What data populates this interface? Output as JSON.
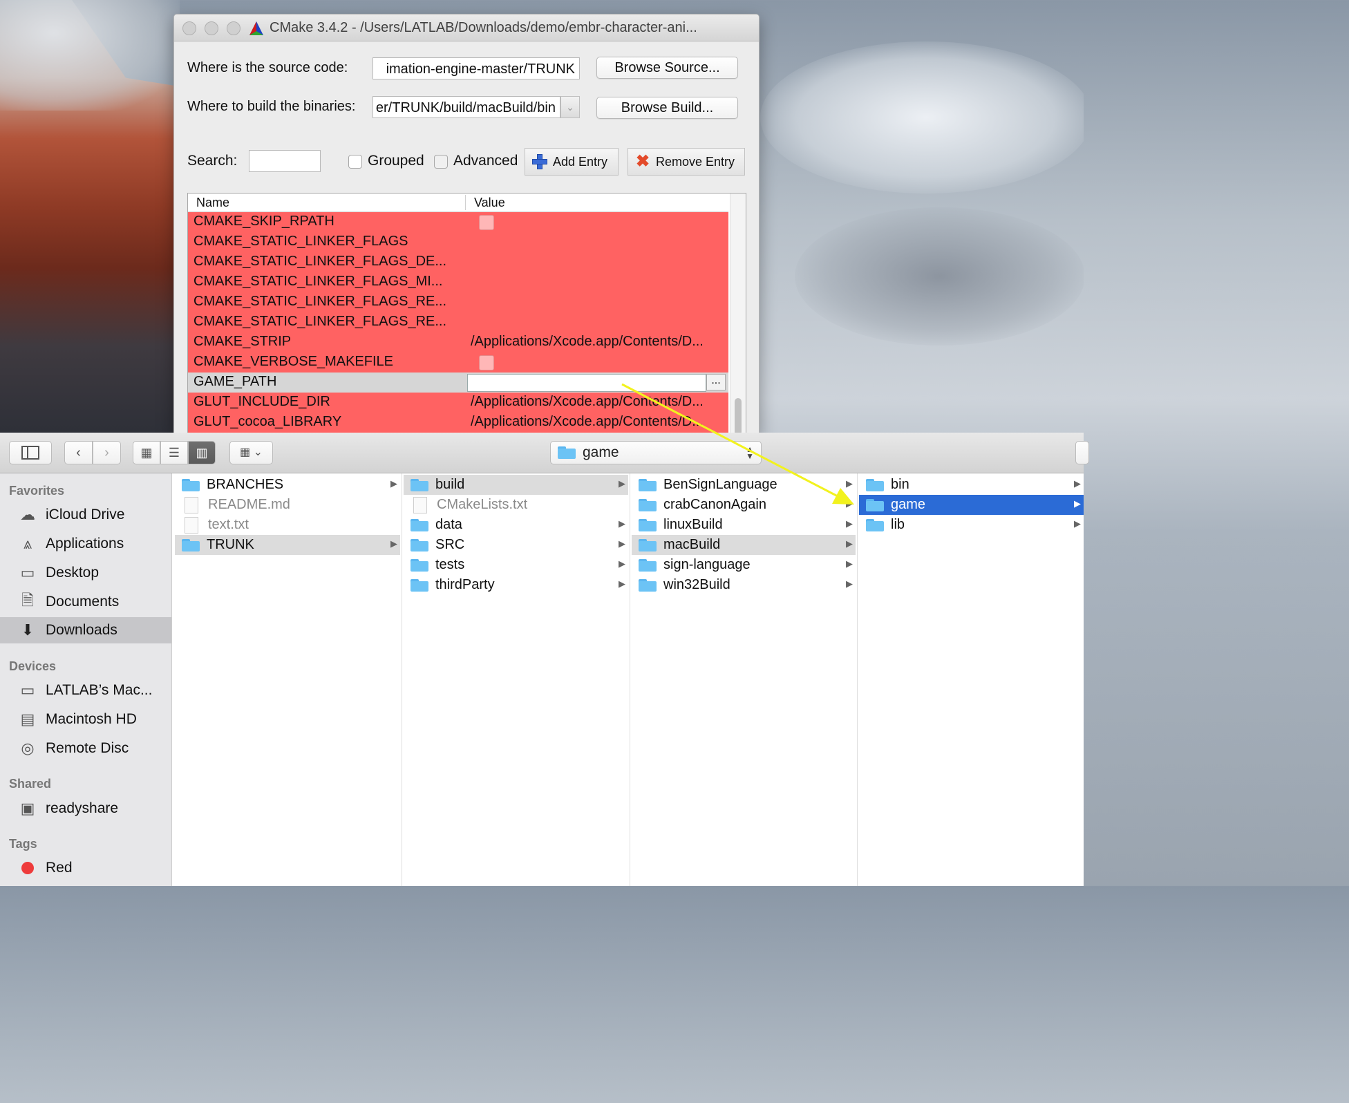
{
  "cmake": {
    "title": "CMake 3.4.2 - /Users/LATLAB/Downloads/demo/embr-character-ani...",
    "source_label": "Where is the source code:",
    "source_value": "imation-engine-master/TRUNK",
    "build_label": "Where to build the binaries:",
    "build_value": "er/TRUNK/build/macBuild/bin",
    "browse_source": "Browse Source...",
    "browse_build": "Browse Build...",
    "search_label": "Search:",
    "grouped_label": "Grouped",
    "advanced_label": "Advanced",
    "add_entry": "Add Entry",
    "remove_entry": "Remove Entry",
    "col_name": "Name",
    "col_value": "Value",
    "rows": [
      {
        "name": "CMAKE_SKIP_RPATH",
        "value": ""
      },
      {
        "name": "CMAKE_STATIC_LINKER_FLAGS",
        "value": ""
      },
      {
        "name": "CMAKE_STATIC_LINKER_FLAGS_DE...",
        "value": ""
      },
      {
        "name": "CMAKE_STATIC_LINKER_FLAGS_MI...",
        "value": ""
      },
      {
        "name": "CMAKE_STATIC_LINKER_FLAGS_RE...",
        "value": ""
      },
      {
        "name": "CMAKE_STATIC_LINKER_FLAGS_RE...",
        "value": ""
      },
      {
        "name": "CMAKE_STRIP",
        "value": "/Applications/Xcode.app/Contents/D..."
      },
      {
        "name": "CMAKE_VERBOSE_MAKEFILE",
        "value": ""
      },
      {
        "name": "GAME_PATH",
        "value": ""
      },
      {
        "name": "GLUT_INCLUDE_DIR",
        "value": "/Applications/Xcode.app/Contents/D..."
      },
      {
        "name": "GLUT_cocoa_LIBRARY",
        "value": "/Applications/Xcode.app/Contents/D..."
      }
    ],
    "ellipsis": "..."
  },
  "finder": {
    "path_popup": "game",
    "sidebar": {
      "favorites_head": "Favorites",
      "favorites": [
        "iCloud Drive",
        "Applications",
        "Desktop",
        "Documents",
        "Downloads"
      ],
      "devices_head": "Devices",
      "devices": [
        "LATLAB’s Mac...",
        "Macintosh HD",
        "Remote Disc"
      ],
      "shared_head": "Shared",
      "shared": [
        "readyshare"
      ],
      "tags_head": "Tags",
      "tags": [
        "Red"
      ]
    },
    "col1": [
      "BRANCHES",
      "README.md",
      "text.txt",
      "TRUNK"
    ],
    "col2": [
      "build",
      "CMakeLists.txt",
      "data",
      "SRC",
      "tests",
      "thirdParty"
    ],
    "col3": [
      "BenSignLanguage",
      "crabCanonAgain",
      "linuxBuild",
      "macBuild",
      "sign-language",
      "win32Build"
    ],
    "col4": [
      "bin",
      "game",
      "lib"
    ]
  },
  "colors": {
    "table_row_red": "#ff6262",
    "selection_blue": "#2b6bd6",
    "annotation_arrow": "#f2f21e",
    "tag_red": "#ee3b3b"
  }
}
